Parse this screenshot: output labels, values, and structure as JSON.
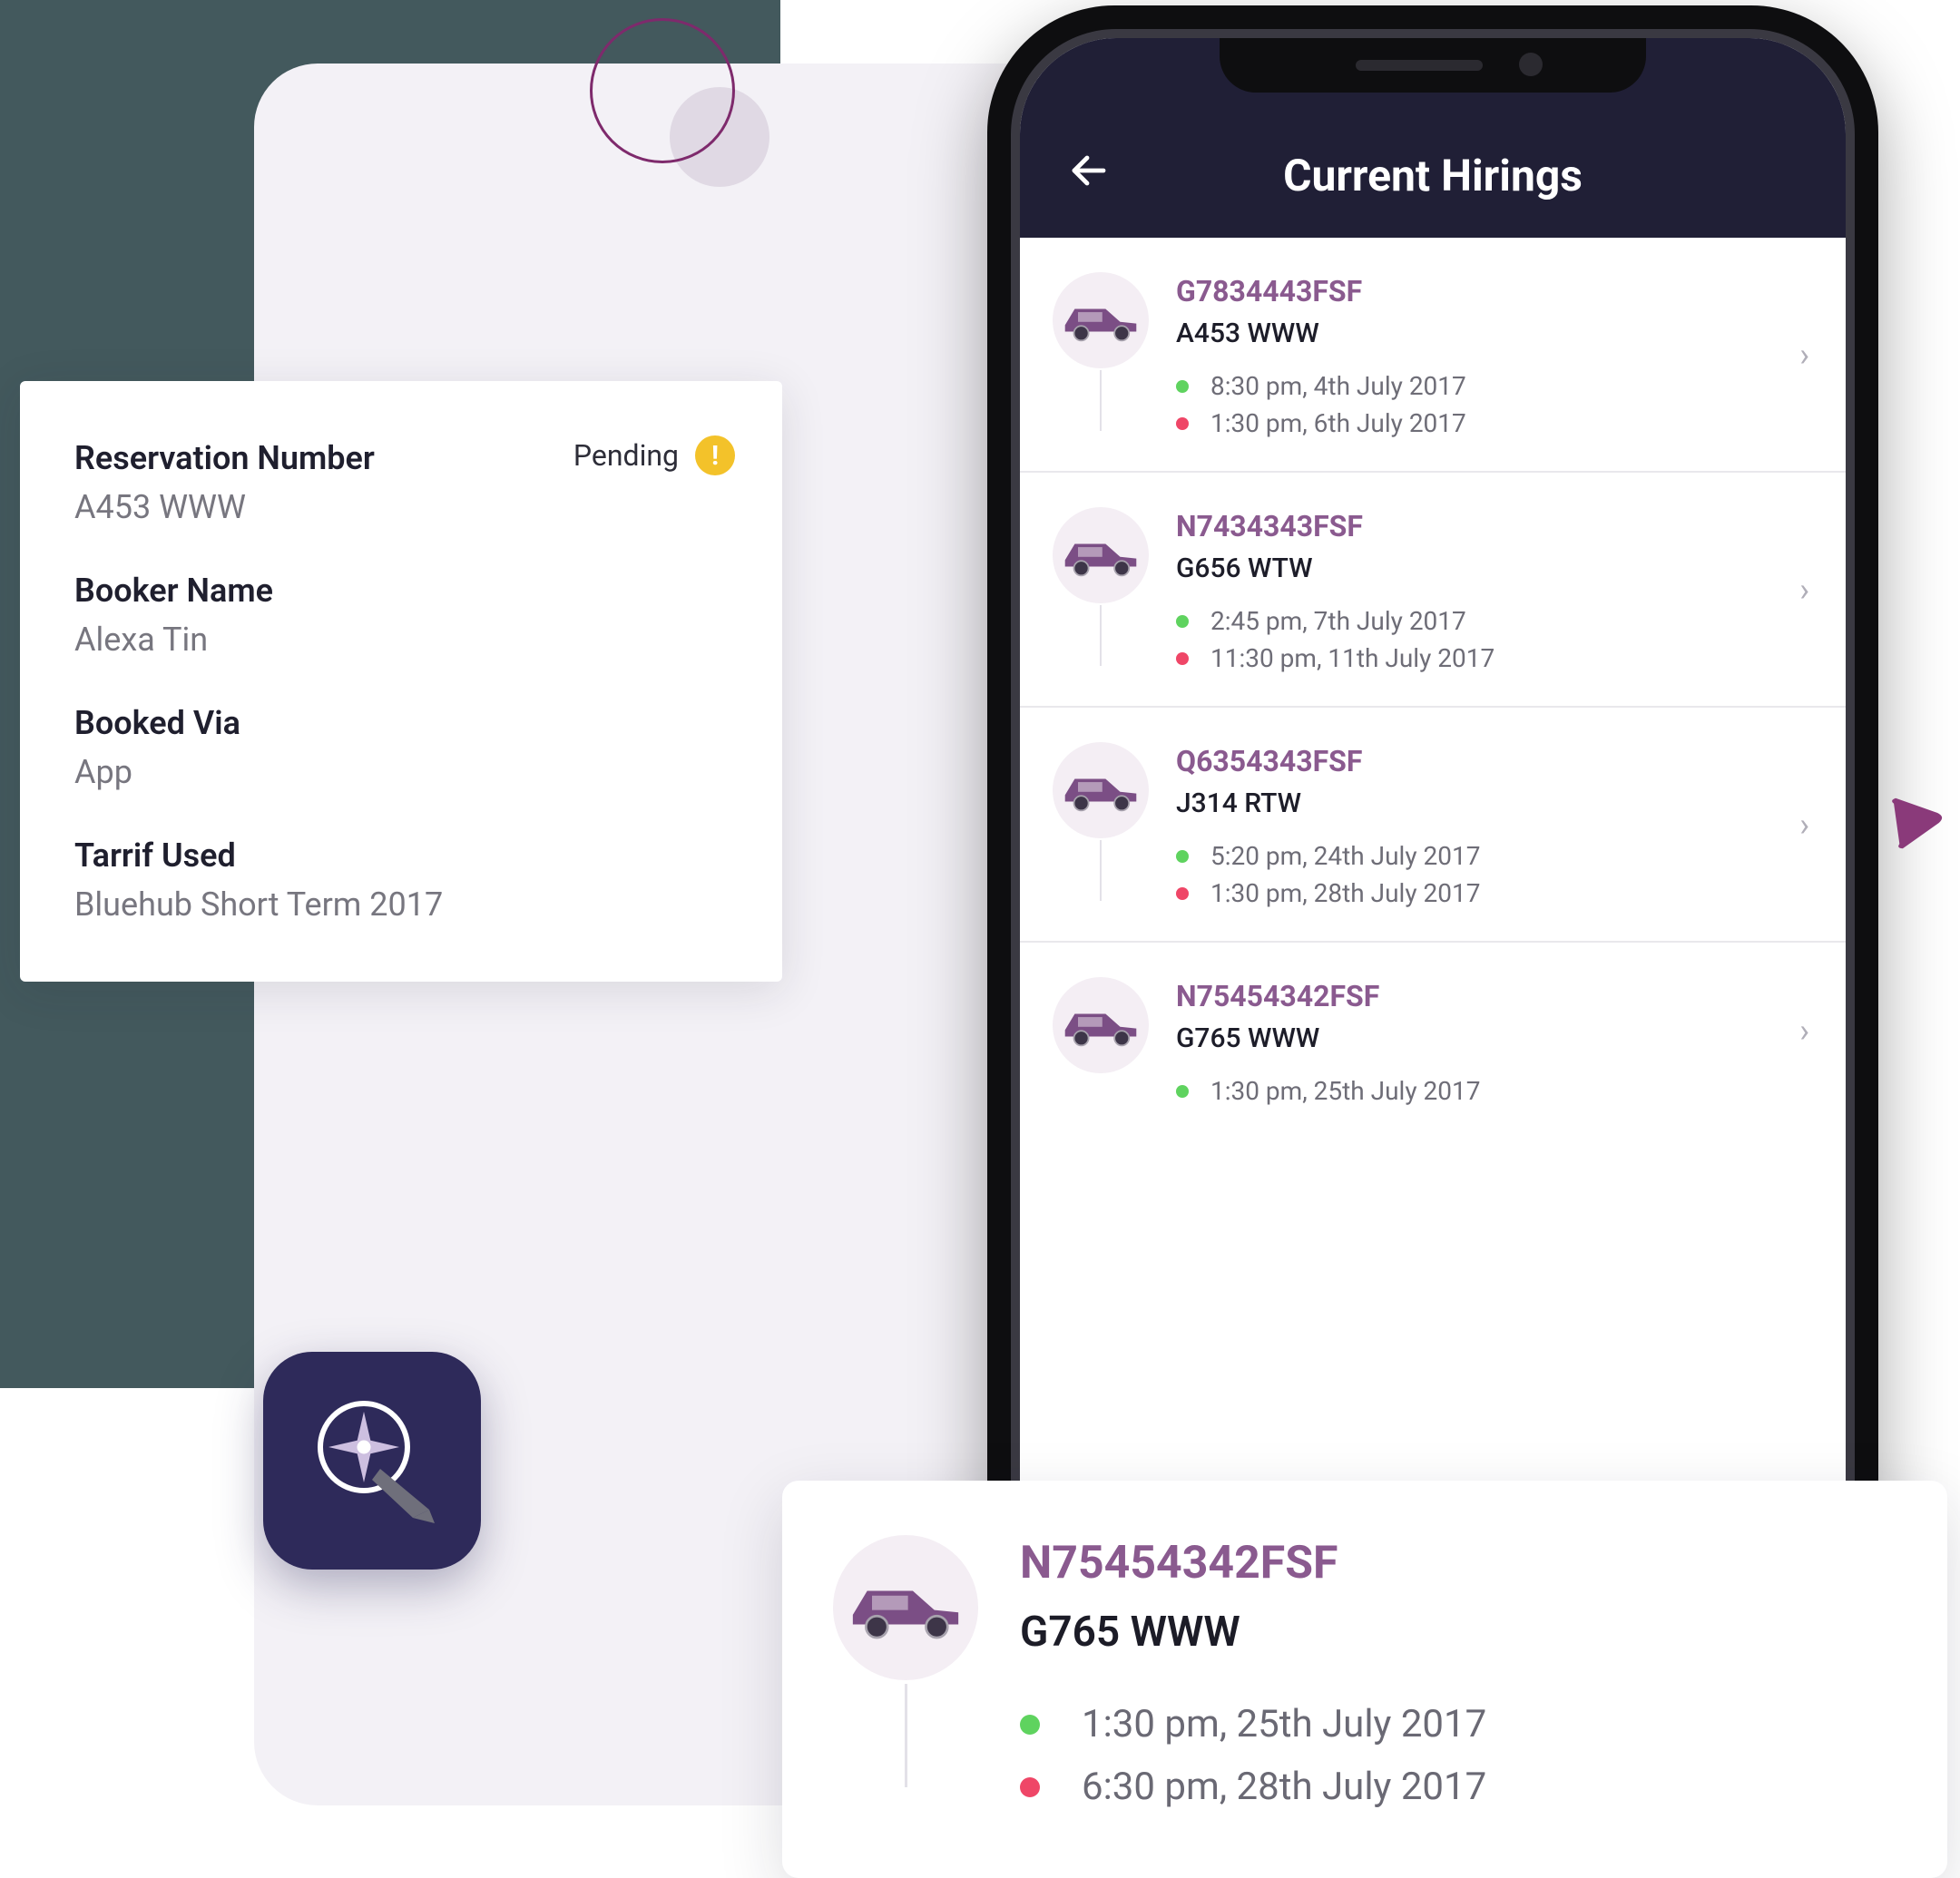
{
  "colors": {
    "accent": "#8a5a8f",
    "header_bg": "#201f36",
    "dot_start": "#5fd35f",
    "dot_end": "#ef4667",
    "status_bg": "#f3c22a"
  },
  "app": {
    "header_title": "Current Hirings"
  },
  "hirings": [
    {
      "id": "G7834443FSF",
      "plate": "A453 WWW",
      "start": "8:30 pm, 4th July 2017",
      "end": "1:30 pm, 6th July 2017"
    },
    {
      "id": "N7434343FSF",
      "plate": "G656 WTW",
      "start": "2:45 pm, 7th July 2017",
      "end": "11:30 pm, 11th July 2017"
    },
    {
      "id": "Q6354343FSF",
      "plate": "J314 RTW",
      "start": "5:20 pm, 24th July 2017",
      "end": "1:30 pm, 28th July 2017"
    },
    {
      "id": "N75454342FSF",
      "plate": "G765 WWW",
      "start": "1:30 pm, 25th July 2017",
      "end": ""
    }
  ],
  "detail": {
    "status": "Pending",
    "fields": {
      "reservation_label": "Reservation Number",
      "reservation_value": "A453 WWW",
      "booker_label": "Booker Name",
      "booker_value": "Alexa Tin",
      "via_label": "Booked Via",
      "via_value": "App",
      "tariff_label": "Tarrif Used",
      "tariff_value": "Bluehub Short Term 2017"
    }
  },
  "float": {
    "id": "N75454342FSF",
    "plate": "G765 WWW",
    "start": "1:30 pm, 25th July 2017",
    "end": "6:30 pm, 28th July 2017"
  }
}
